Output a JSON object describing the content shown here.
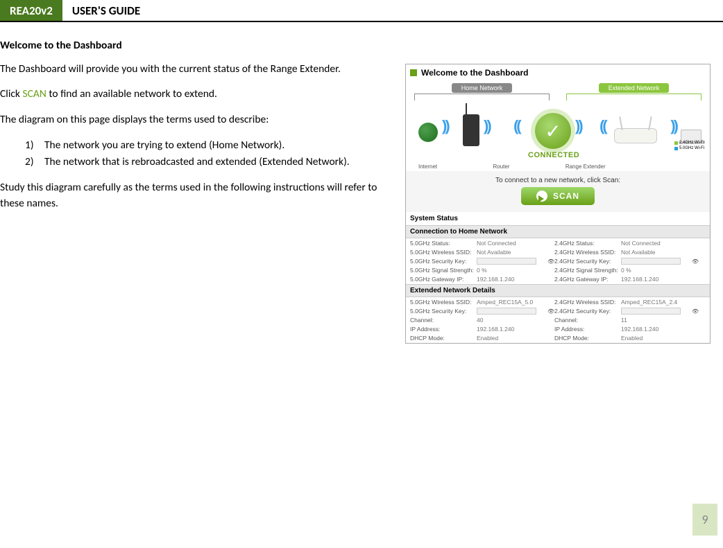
{
  "header": {
    "brand": "REA20v2",
    "title": "USER'S GUIDE"
  },
  "section_title": "Welcome to the Dashboard",
  "para1": "The Dashboard will provide you with the current status of the Range Extender.",
  "para2_pre": "Click ",
  "para2_scan": "SCAN",
  "para2_post": " to find an available network to extend.",
  "para3": "The diagram on this page displays the terms used to describe:",
  "list": {
    "n1": "1)",
    "t1": "The network you are trying to extend (Home Network).",
    "n2": "2)",
    "t2": "The network that is rebroadcasted and extended (Extended Network)."
  },
  "para4": "Study this diagram carefully as the terms used in the following instructions will refer to these names.",
  "figure": {
    "dash_title": "Welcome to the Dashboard",
    "home_label": "Home Network",
    "ext_label": "Extended Network",
    "connected": "CONNECTED",
    "dev_internet": "Internet",
    "dev_router": "Router",
    "dev_extender": "Range Extender",
    "legend24": "2.4GHz Wi-Fi",
    "legend5": "5.0GHz Wi-Fi",
    "connect_prompt": "To connect to a new network, click Scan:",
    "scan_btn": "SCAN",
    "sys_status": "System Status",
    "conn_home_hdr": "Connection to Home Network",
    "ext_details_hdr": "Extended Network Details",
    "home": {
      "r1l": "5.0GHz Status:",
      "r1v": "Not Connected",
      "r1l2": "2.4GHz Status:",
      "r1v2": "Not Connected",
      "r2l": "5.0GHz Wireless SSID:",
      "r2v": "Not Available",
      "r2l2": "2.4GHz Wireless SSID:",
      "r2v2": "Not Available",
      "r3l": "5.0GHz Security Key:",
      "r3l2": "2.4GHz Security Key:",
      "r4l": "5.0GHz Signal Strength:",
      "r4v": "0 %",
      "r4l2": "2.4GHz Signal Strength:",
      "r4v2": "0 %",
      "r5l": "5.0GHz Gateway IP:",
      "r5v": "192.168.1.240",
      "r5l2": "2.4GHz Gateway IP:",
      "r5v2": "192.168.1.240"
    },
    "ext": {
      "r1l": "5.0GHz Wireless SSID:",
      "r1v": "Amped_REC15A_5.0",
      "r1l2": "2.4GHz Wireless SSID:",
      "r1v2": "Amped_REC15A_2.4",
      "r2l": "5.0GHz Security Key:",
      "r2l2": "2.4GHz Security Key:",
      "r3l": "Channel:",
      "r3v": "40",
      "r3l2": "Channel:",
      "r3v2": "11",
      "r4l": "IP Address:",
      "r4v": "192.168.1.240",
      "r4l2": "IP Address:",
      "r4v2": "192.168.1.240",
      "r5l": "DHCP Mode:",
      "r5v": "Enabled",
      "r5l2": "DHCP Mode:",
      "r5v2": "Enabled"
    }
  },
  "page_number": "9"
}
